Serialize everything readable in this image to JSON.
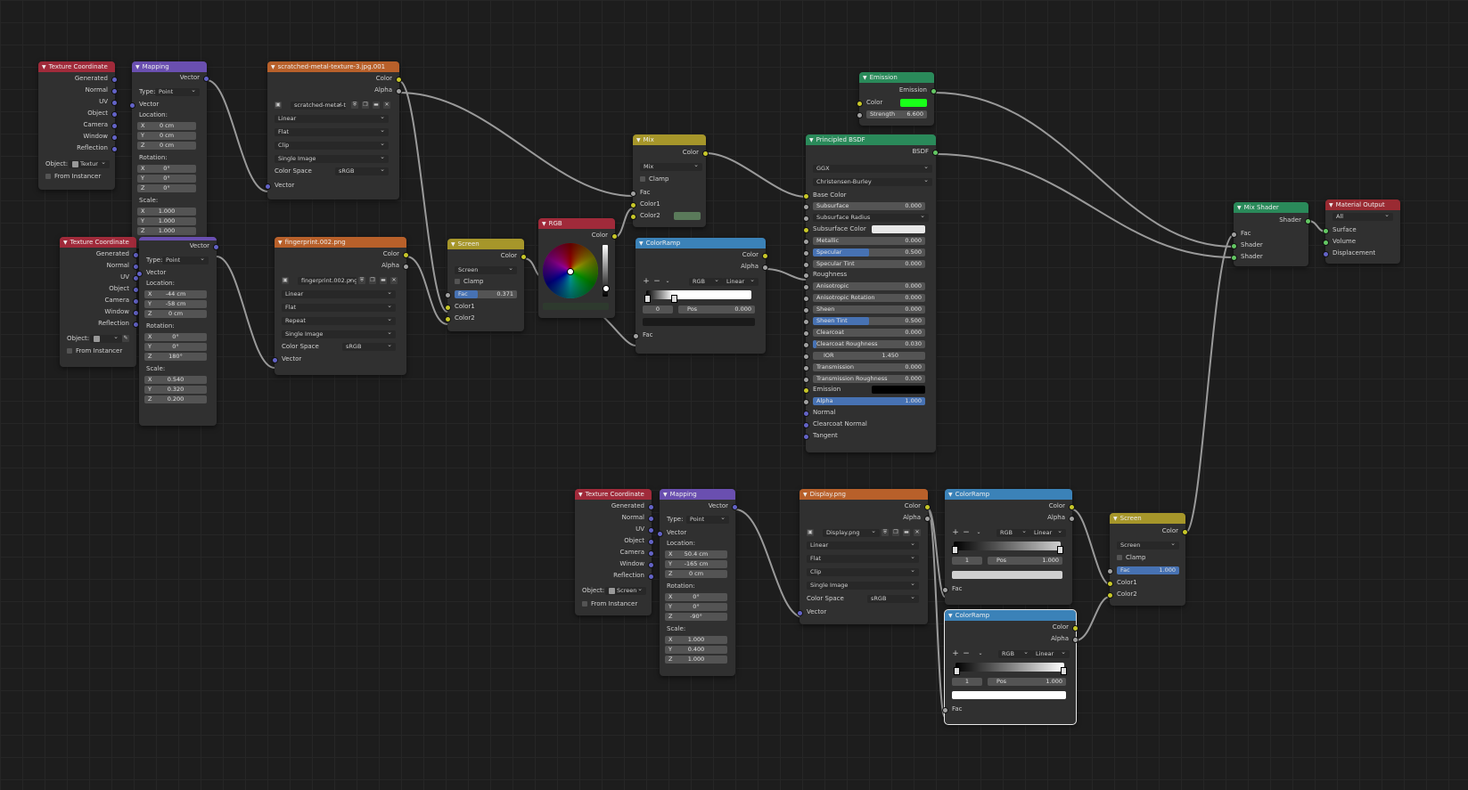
{
  "colors": {
    "input_header": "#a02a3a",
    "vector_header": "#6a4fb0",
    "texture_header": "#b8602a",
    "color_header": "#a6962a",
    "converter_header": "#3b82b8",
    "shader_header": "#2a8a5a",
    "output_header": "#9a2a32",
    "rgb_header": "#a02a3a"
  },
  "tc1": {
    "title": "Texture Coordinate",
    "outputs": [
      "Generated",
      "Normal",
      "UV",
      "Object",
      "Camera",
      "Window",
      "Reflection"
    ],
    "object_label": "Object:",
    "object_value": "Textur",
    "from_instancer": "From Instancer"
  },
  "map1": {
    "title": "Mapping",
    "out": "Vector",
    "type_label": "Type:",
    "type_value": "Point",
    "vector_in": "Vector",
    "location": "Location:",
    "loc": [
      [
        "X",
        "0 cm"
      ],
      [
        "Y",
        "0 cm"
      ],
      [
        "Z",
        "0 cm"
      ]
    ],
    "rotation": "Rotation:",
    "rot": [
      [
        "X",
        "0°"
      ],
      [
        "Y",
        "0°"
      ],
      [
        "Z",
        "0°"
      ]
    ],
    "scale": "Scale:",
    "scl": [
      [
        "X",
        "1.000"
      ],
      [
        "Y",
        "1.000"
      ],
      [
        "Z",
        "1.000"
      ]
    ]
  },
  "tc2": {
    "title": "Texture Coordinate",
    "outputs": [
      "Generated",
      "Normal",
      "UV",
      "Object",
      "Camera",
      "Window",
      "Reflection"
    ],
    "object_label": "Object:",
    "from_instancer": "From Instancer"
  },
  "map2": {
    "out": "Vector",
    "type_label": "Type:",
    "type_value": "Point",
    "vector_in": "Vector",
    "location": "Location:",
    "loc": [
      [
        "X",
        "-44 cm"
      ],
      [
        "Y",
        "-58 cm"
      ],
      [
        "Z",
        "0 cm"
      ]
    ],
    "rotation": "Rotation:",
    "rot": [
      [
        "X",
        "0°"
      ],
      [
        "Y",
        "0°"
      ],
      [
        "Z",
        "180°"
      ]
    ],
    "scale": "Scale:",
    "scl": [
      [
        "X",
        "0.540"
      ],
      [
        "Y",
        "0.320"
      ],
      [
        "Z",
        "0.200"
      ]
    ]
  },
  "img1": {
    "title": "scratched-metal-texture-3.jpg.001",
    "out_color": "Color",
    "out_alpha": "Alpha",
    "image_name": "scratched-metal-te...",
    "interp": "Linear",
    "proj": "Flat",
    "ext": "Clip",
    "source": "Single Image",
    "cs_label": "Color Space",
    "cs_value": "sRGB",
    "vector_in": "Vector"
  },
  "img2": {
    "title": "fingerprint.002.png",
    "out_color": "Color",
    "out_alpha": "Alpha",
    "image_name": "fingerprint.002.png",
    "interp": "Linear",
    "proj": "Flat",
    "ext": "Repeat",
    "source": "Single Image",
    "cs_label": "Color Space",
    "cs_value": "sRGB",
    "vector_in": "Vector"
  },
  "screen1": {
    "title": "Screen",
    "out": "Color",
    "mode": "Screen",
    "clamp": "Clamp",
    "fac_label": "Fac",
    "fac_value": "0.371",
    "fac_fraction": 0.371,
    "c1": "Color1",
    "c2": "Color2"
  },
  "rgb": {
    "title": "RGB",
    "out": "Color"
  },
  "mix": {
    "title": "Mix",
    "out": "Color",
    "mode": "Mix",
    "clamp": "Clamp",
    "fac": "Fac",
    "c1": "Color1",
    "c2": "Color2",
    "c2_color": "#5a7a5a"
  },
  "ramp1": {
    "title": "ColorRamp",
    "out_color": "Color",
    "out_alpha": "Alpha",
    "mode": "RGB",
    "interp": "Linear",
    "index": "0",
    "pos_label": "Pos",
    "pos_value": "0.000",
    "fac": "Fac",
    "stop_color": "#1a1a1a"
  },
  "emission": {
    "title": "Emission",
    "out": "Emission",
    "color_label": "Color",
    "color": "#19ff19",
    "strength_label": "Strength",
    "strength": "6.600"
  },
  "bsdf": {
    "title": "Principled BSDF",
    "out": "BSDF",
    "dist": "GGX",
    "sss": "Christensen-Burley",
    "base_color": "Base Color",
    "fields": [
      {
        "k": "Subsurface",
        "v": "0.000",
        "f": 0
      },
      {
        "k": "Subsurface Radius",
        "v": "",
        "f": 0,
        "dd": true
      },
      {
        "k": "Subsurface Color",
        "v": "",
        "f": 0,
        "sw": "#e8e8e8"
      },
      {
        "k": "Metallic",
        "v": "0.000",
        "f": 0
      },
      {
        "k": "Specular",
        "v": "0.500",
        "f": 0.5
      },
      {
        "k": "Specular Tint",
        "v": "0.000",
        "f": 0
      },
      {
        "k": "Roughness",
        "v": "",
        "f": 0,
        "plain": true
      },
      {
        "k": "Anisotropic",
        "v": "0.000",
        "f": 0
      },
      {
        "k": "Anisotropic Rotation",
        "v": "0.000",
        "f": 0
      },
      {
        "k": "Sheen",
        "v": "0.000",
        "f": 0
      },
      {
        "k": "Sheen Tint",
        "v": "0.500",
        "f": 0.5
      },
      {
        "k": "Clearcoat",
        "v": "0.000",
        "f": 0
      },
      {
        "k": "Clearcoat Roughness",
        "v": "0.030",
        "f": 0.03
      },
      {
        "k": "IOR",
        "v": "1.450",
        "f": 0,
        "c": true
      },
      {
        "k": "Transmission",
        "v": "0.000",
        "f": 0
      },
      {
        "k": "Transmission Roughness",
        "v": "0.000",
        "f": 0
      },
      {
        "k": "Emission",
        "v": "",
        "f": 0,
        "sw": "#000000"
      },
      {
        "k": "Alpha",
        "v": "1.000",
        "f": 1
      },
      {
        "k": "Normal",
        "v": "",
        "f": 0,
        "plain": true
      },
      {
        "k": "Clearcoat Normal",
        "v": "",
        "f": 0,
        "plain": true
      },
      {
        "k": "Tangent",
        "v": "",
        "f": 0,
        "plain": true
      }
    ]
  },
  "mixshader": {
    "title": "Mix Shader",
    "out": "Shader",
    "fac": "Fac",
    "s1": "Shader",
    "s2": "Shader"
  },
  "output": {
    "title": "Material Output",
    "target": "All",
    "surface": "Surface",
    "volume": "Volume",
    "displacement": "Displacement"
  },
  "tc3": {
    "title": "Texture Coordinate",
    "outputs": [
      "Generated",
      "Normal",
      "UV",
      "Object",
      "Camera",
      "Window",
      "Reflection"
    ],
    "object_label": "Object:",
    "object_value": "Screen",
    "from_instancer": "From Instancer"
  },
  "map3": {
    "title": "Mapping",
    "out": "Vector",
    "type_label": "Type:",
    "type_value": "Point",
    "vector_in": "Vector",
    "location": "Location:",
    "loc": [
      [
        "X",
        "50.4 cm"
      ],
      [
        "Y",
        "-165 cm"
      ],
      [
        "Z",
        "0 cm"
      ]
    ],
    "rotation": "Rotation:",
    "rot": [
      [
        "X",
        "0°"
      ],
      [
        "Y",
        "0°"
      ],
      [
        "Z",
        "-90°"
      ]
    ],
    "scale": "Scale:",
    "scl": [
      [
        "X",
        "1.000"
      ],
      [
        "Y",
        "0.400"
      ],
      [
        "Z",
        "1.000"
      ]
    ]
  },
  "img3": {
    "title": "Display.png",
    "out_color": "Color",
    "out_alpha": "Alpha",
    "image_name": "Display.png",
    "interp": "Linear",
    "proj": "Flat",
    "ext": "Clip",
    "source": "Single Image",
    "cs_label": "Color Space",
    "cs_value": "sRGB",
    "vector_in": "Vector"
  },
  "ramp2": {
    "title": "ColorRamp",
    "out_color": "Color",
    "out_alpha": "Alpha",
    "mode": "RGB",
    "interp": "Linear",
    "index": "1",
    "pos_label": "Pos",
    "pos_value": "1.000",
    "fac": "Fac",
    "stop_color": "#d0d0d0"
  },
  "ramp3": {
    "title": "ColorRamp",
    "out_color": "Color",
    "out_alpha": "Alpha",
    "mode": "RGB",
    "interp": "Linear",
    "index": "1",
    "pos_label": "Pos",
    "pos_value": "1.000",
    "fac": "Fac",
    "stop_color": "#ffffff"
  },
  "screen2": {
    "title": "Screen",
    "out": "Color",
    "mode": "Screen",
    "clamp": "Clamp",
    "fac_label": "Fac",
    "fac_value": "1.000",
    "fac_fraction": 1.0,
    "c1": "Color1",
    "c2": "Color2"
  }
}
